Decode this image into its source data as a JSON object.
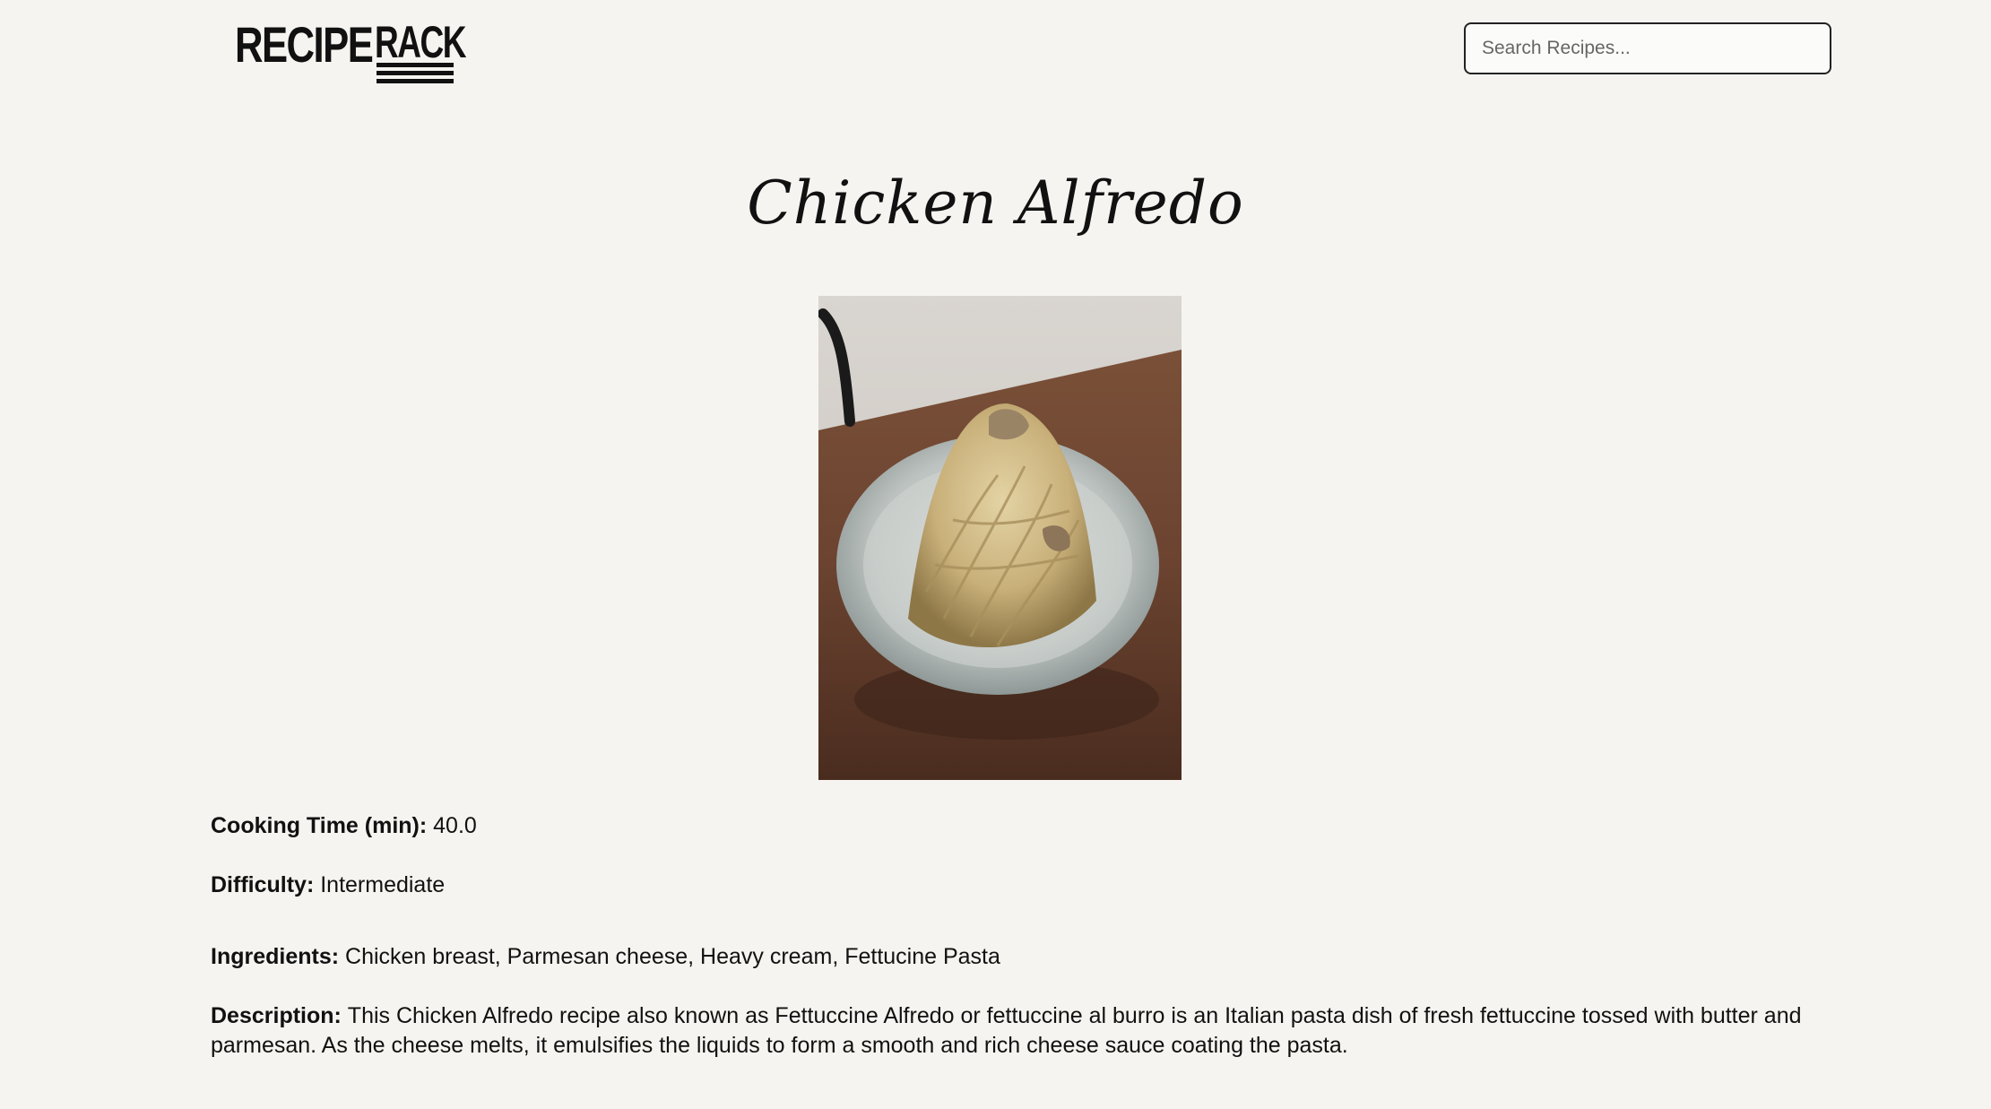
{
  "header": {
    "logo": {
      "word1": "RECIPE",
      "word2": "RACK"
    },
    "search": {
      "placeholder": "Search Recipes...",
      "value": ""
    }
  },
  "recipe": {
    "title": "Chicken Alfredo",
    "image_alt": "Chicken Alfredo",
    "cooking_time": {
      "label": "Cooking Time (min):",
      "value": "40.0"
    },
    "difficulty": {
      "label": "Difficulty:",
      "value": "Intermediate"
    },
    "ingredients": {
      "label": "Ingredients:",
      "value": "Chicken breast, Parmesan cheese, Heavy cream, Fettucine Pasta"
    },
    "description": {
      "label": "Description:",
      "value": "This Chicken Alfredo recipe also known as Fettuccine Alfredo or fettuccine al burro is an Italian pasta dish of fresh fettuccine tossed with butter and parmesan. As the cheese melts, it emulsifies the liquids to form a smooth and rich cheese sauce coating the pasta."
    }
  },
  "colors": {
    "background": "#f5f4f0",
    "text": "#111111",
    "search_border": "#222222"
  }
}
